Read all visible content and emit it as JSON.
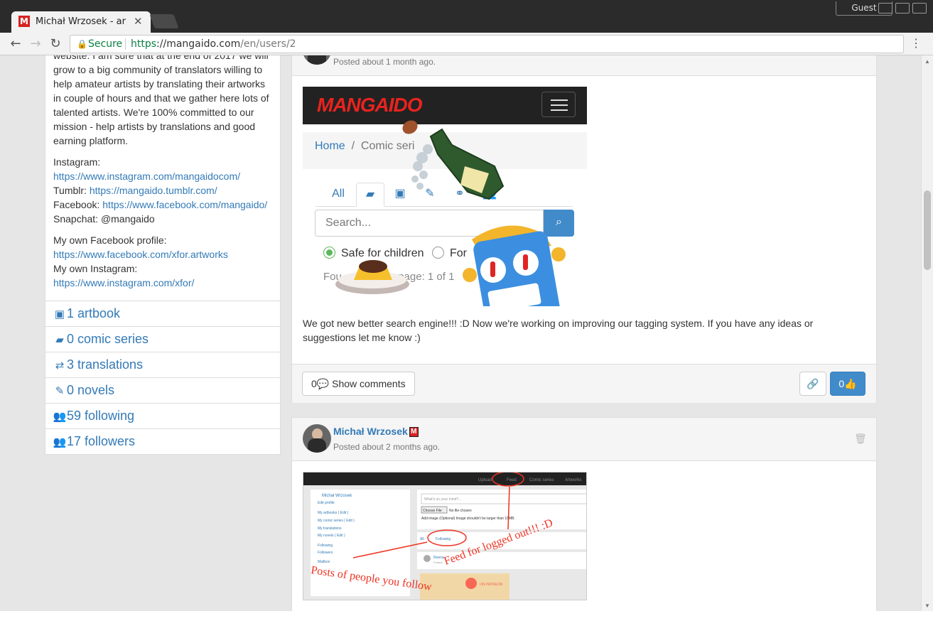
{
  "browser": {
    "tab_title": "Michał Wrzosek - ar",
    "tab_favicon": "M",
    "guest_label": "Guest",
    "secure_label": "Secure",
    "url_scheme": "https",
    "url_sep": "://",
    "url_host": "mangaido.com",
    "url_path": "/en/users/2"
  },
  "profile": {
    "bio_lines": [
      "website. I am sure that at the end of 2017 we will",
      "grow to a big community of translators willing to",
      "help amateur artists by translating their artworks",
      "in couple of hours and that we gather here lots of",
      "talented artists. We're 100% committed to our",
      "mission - help artists by translations and good",
      "earning platform."
    ],
    "instagram_label": "Instagram:",
    "instagram_url": "https://www.instagram.com/mangaidocom/",
    "tumblr_label": "Tumblr:",
    "tumblr_url": "https://mangaido.tumblr.com/",
    "facebook_label": "Facebook:",
    "facebook_url": "https://www.facebook.com/mangaido/",
    "snapchat": "Snapchat: @mangaido",
    "own_fb_label": "My own Facebook profile:",
    "own_fb_url": "https://www.facebook.com/xfor.artworks",
    "own_ig_label": "My own Instagram:",
    "own_ig_url": "https://www.instagram.com/xfor/",
    "stats": [
      {
        "label": "1 artbook",
        "icon": "image-icon"
      },
      {
        "label": "0 comic series",
        "icon": "book-icon"
      },
      {
        "label": "3 translations",
        "icon": "translate-icon"
      },
      {
        "label": "0 novels",
        "icon": "edit-icon"
      },
      {
        "label": "59 following",
        "icon": "users-icon"
      },
      {
        "label": "17 followers",
        "icon": "users-icon"
      }
    ]
  },
  "post1": {
    "time": "Posted about 1 month ago.",
    "text": "We got new better search engine!!! :D Now we're working on improving our tagging system. If you have any ideas or suggestions let me know :)",
    "comments_count": "0",
    "comments_label": "Show comments",
    "likes": "0",
    "mock": {
      "logo": "MANGAIDO",
      "crumb_home": "Home",
      "crumb_sep": "/",
      "crumb_current": "Comic seri",
      "tab_all": "All",
      "search_placeholder": "Search...",
      "radio_safe": "Safe for children",
      "radio_other": "For",
      "found": "Fou",
      "found_rest": "lts, page: 1 of 1"
    }
  },
  "post2": {
    "author": "Michał Wrzosek",
    "badge": "M",
    "time": "Posted about 2 months ago.",
    "shot": {
      "nav_upload": "Upload",
      "nav_feed": "Feed",
      "nav_comic": "Comic series",
      "nav_artworks": "Artworks",
      "side_name": "Michał Wrzosek",
      "side_edit": "Edit profile",
      "side_artbooks": "My artbooks ( Edit )",
      "side_comics": "My comic series ( Edit )",
      "side_trans": "My translations",
      "side_novels": "My novels ( Edit )",
      "side_following": "Following",
      "side_followers": "Followers",
      "side_mailbox": "Mailbox",
      "mind_placeholder": "What's on your mind?...",
      "choose_file": "Choose File",
      "no_file": "No file chosen",
      "add_image": "Add image (Optional) Image shouldn't be larger than 15MB.",
      "tab_all": "All",
      "tab_following": "Following",
      "feed_user": "Reena",
      "feed_time": "Posted",
      "patreon": "ON PATREON",
      "annot_feed": "Feed for logged out!!! :D",
      "annot_posts": "Posts of people you follow"
    }
  }
}
